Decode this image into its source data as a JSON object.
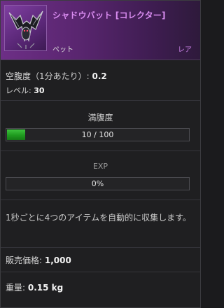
{
  "item": {
    "name": "シャドウバット [コレクター]",
    "type": "ペット",
    "rarity": "レア",
    "icon": "shadow-bat-icon"
  },
  "stats": {
    "hunger_label": "空腹度（1分あたり）:",
    "hunger_value": "0.2",
    "level_label": "レベル:",
    "level_value": "30"
  },
  "satiety": {
    "label": "満腹度",
    "text": "10 / 100",
    "fraction": 0.1
  },
  "exp": {
    "label": "EXP",
    "text": "0%",
    "fraction": 0
  },
  "description": "1秒ごとに4つのアイテムを自動的に収集します。",
  "price": {
    "label": "販売価格:",
    "value": "1,000"
  },
  "weight": {
    "label": "重量:",
    "value": "0.15 kg"
  },
  "colors": {
    "header": "#6d2f86",
    "name": "#d98cf0",
    "bar_fill": "#2aa82a"
  }
}
